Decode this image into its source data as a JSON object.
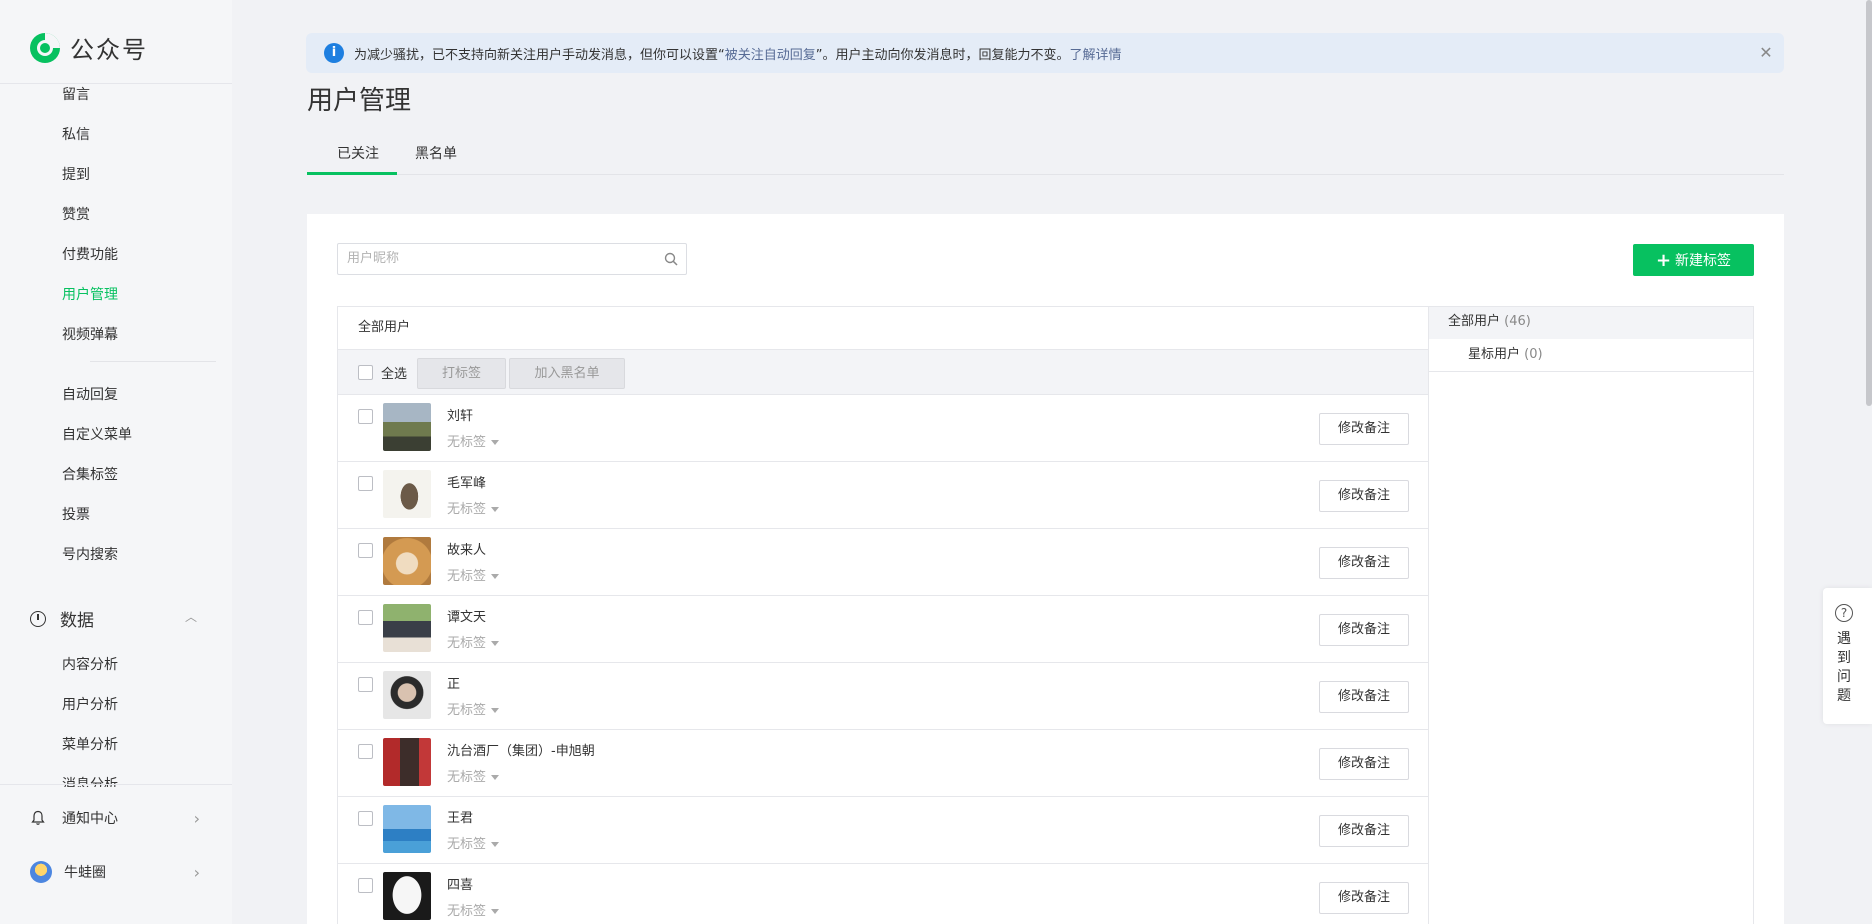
{
  "brand": {
    "name": "公众号"
  },
  "sidebar": {
    "items": [
      {
        "label": "留言",
        "active": false
      },
      {
        "label": "私信",
        "active": false
      },
      {
        "label": "提到",
        "active": false
      },
      {
        "label": "赞赏",
        "active": false
      },
      {
        "label": "付费功能",
        "active": false
      },
      {
        "label": "用户管理",
        "active": true
      },
      {
        "label": "视频弹幕",
        "active": false
      },
      {
        "label": "自动回复",
        "active": false
      },
      {
        "label": "自定义菜单",
        "active": false
      },
      {
        "label": "合集标签",
        "active": false
      },
      {
        "label": "投票",
        "active": false
      },
      {
        "label": "号内搜索",
        "active": false
      }
    ],
    "data_group": {
      "label": "数据",
      "items": [
        "内容分析",
        "用户分析",
        "菜单分析",
        "消息分析"
      ]
    },
    "notification_center": "通知中心",
    "account_name": "牛蛙圈"
  },
  "notice": {
    "text_before": "为减少骚扰，已不支持向新关注用户手动发消息，但你可以设置“",
    "link_auto_reply": "被关注自动回复",
    "text_after": "”。用户主动向你发消息时，回复能力不变。",
    "link_learn_more": "了解详情"
  },
  "page_title": "用户管理",
  "tabs": [
    {
      "label": "已关注",
      "active": true
    },
    {
      "label": "黑名单",
      "active": false
    }
  ],
  "search": {
    "placeholder": "用户昵称"
  },
  "new_tag_button": "新建标签",
  "table": {
    "header": "全部用户",
    "select_all": "全选",
    "tag_button": "打标签",
    "blacklist_button": "加入黑名单",
    "remark_button": "修改备注",
    "no_tag": "无标签",
    "users": [
      {
        "name": "刘轩",
        "tag": "无标签"
      },
      {
        "name": "毛军峰",
        "tag": "无标签"
      },
      {
        "name": "故来人",
        "tag": "无标签"
      },
      {
        "name": "谭文天",
        "tag": "无标签"
      },
      {
        "name": "正",
        "tag": "无标签"
      },
      {
        "name": "氿台酒厂（集团）-申旭朝",
        "tag": "无标签"
      },
      {
        "name": "王君",
        "tag": "无标签"
      },
      {
        "name": "四喜",
        "tag": "无标签"
      }
    ]
  },
  "groups": {
    "all": {
      "label": "全部用户",
      "count": "(46)"
    },
    "starred": {
      "label": "星标用户",
      "count": "(0)"
    }
  },
  "help": {
    "label": "遇到问题"
  },
  "colors": {
    "accent": "#07c160",
    "link": "#576b95",
    "info": "#1e7fe0"
  }
}
